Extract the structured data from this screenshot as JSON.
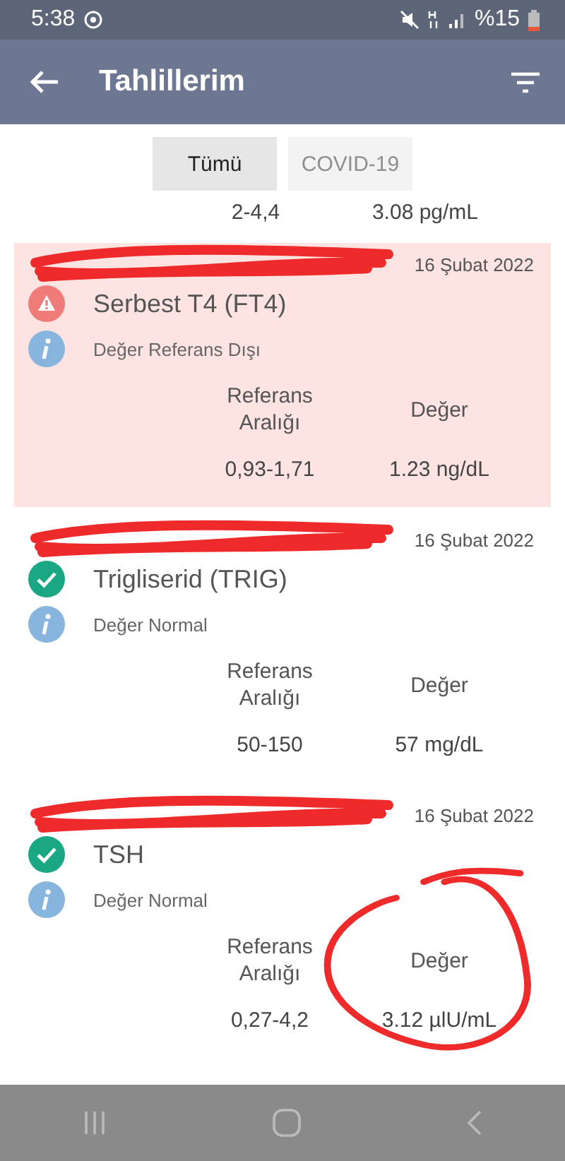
{
  "status_bar": {
    "time": "5:38",
    "battery": "%15"
  },
  "app_bar": {
    "title": "Tahlillerim"
  },
  "filters": [
    {
      "label": "Tümü",
      "selected": true,
      "disabled": false
    },
    {
      "label": "COVID-19",
      "selected": false,
      "disabled": true
    }
  ],
  "previous_row": {
    "range": "2-4,4",
    "value": "3.08 pg/mL"
  },
  "results": [
    {
      "kind": "abnormal",
      "date": "16 Şubat 2022",
      "name": "Serbest T4 (FT4)",
      "note": "Değer Referans Dışı",
      "range_header": "Referans Aralığı",
      "value_header": "Değer",
      "range": "0,93-1,71",
      "value": "1.23 ng/dL",
      "redacted": true,
      "circled": false
    },
    {
      "kind": "normal",
      "date": "16 Şubat 2022",
      "name": "Trigliserid (TRIG)",
      "note": "Değer Normal",
      "range_header": "Referans Aralığı",
      "value_header": "Değer",
      "range": "50-150",
      "value": "57 mg/dL",
      "redacted": true,
      "circled": false
    },
    {
      "kind": "normal",
      "date": "16 Şubat 2022",
      "name": "TSH",
      "note": "Değer Normal",
      "range_header": "Referans Aralığı",
      "value_header": "Değer",
      "range": "0,27-4,2",
      "value": "3.12 µlU/mL",
      "redacted": true,
      "circled": true
    }
  ]
}
